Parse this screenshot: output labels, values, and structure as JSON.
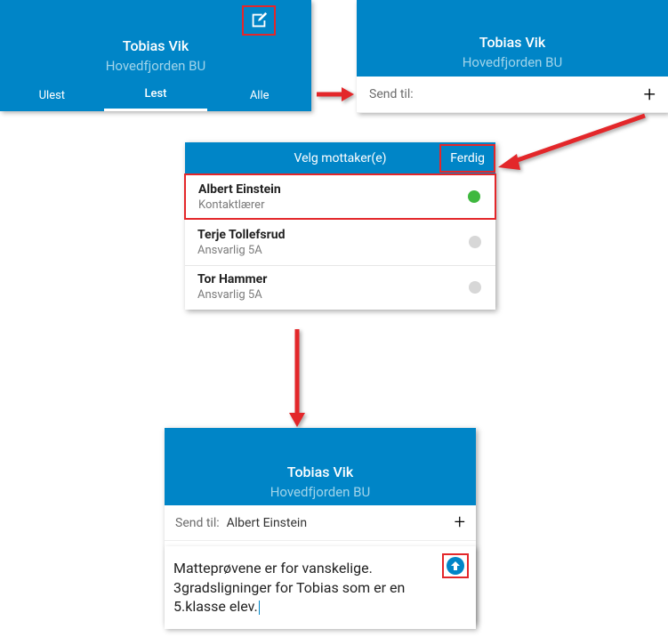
{
  "screen1": {
    "name": "Tobias Vik",
    "subtitle": "Hovedfjorden BU",
    "tabs": [
      "Ulest",
      "Lest",
      "Alle"
    ],
    "active_tab_index": 1
  },
  "screen2": {
    "name": "Tobias Vik",
    "subtitle": "Hovedfjorden BU",
    "send_to_label": "Send til:",
    "plus": "+"
  },
  "screen3": {
    "title": "Velg mottaker(e)",
    "done_label": "Ferdig",
    "contacts": [
      {
        "name": "Albert Einstein",
        "role": "Kontaktlærer",
        "selected": true
      },
      {
        "name": "Terje Tollefsrud",
        "role": "Ansvarlig 5A",
        "selected": false
      },
      {
        "name": "Tor Hammer",
        "role": "Ansvarlig 5A",
        "selected": false
      }
    ]
  },
  "screen4": {
    "name": "Tobias Vik",
    "subtitle": "Hovedfjorden BU",
    "send_to_label": "Send til:",
    "recipient": "Albert Einstein",
    "plus": "+",
    "message_text": "Matteprøvene er for vanskelige. 3gradsligninger for Tobias som er en 5.klasse elev."
  }
}
